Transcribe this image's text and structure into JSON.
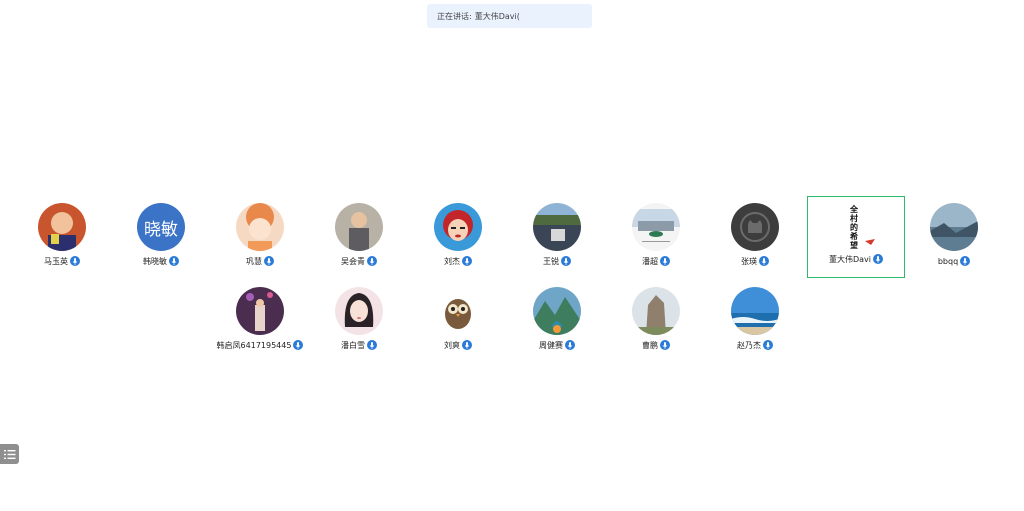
{
  "speaking": {
    "label": "正在讲话:",
    "speaker": "董大伟Davi("
  },
  "participants": [
    {
      "name": "马玉英",
      "avatar_icon": "child-photo-avatar"
    },
    {
      "name": "韩晓敏",
      "avatar_icon": "text-avatar",
      "avatar_text": "晓敏",
      "avatar_color": "#3b73c6"
    },
    {
      "name": "巩慧",
      "avatar_icon": "cartoon-girl-avatar"
    },
    {
      "name": "吴会青",
      "avatar_icon": "child-photo-avatar"
    },
    {
      "name": "刘杰",
      "avatar_icon": "cartoon-redhair-avatar"
    },
    {
      "name": "王锐",
      "avatar_icon": "landscape-avatar"
    },
    {
      "name": "潘超",
      "avatar_icon": "landscape-avatar"
    },
    {
      "name": "张瑛",
      "avatar_icon": "github-cat-avatar"
    },
    {
      "name": "董大伟Davi",
      "avatar_icon": "calligraphy-avatar",
      "avatar_text": "全村的希望",
      "active": true
    },
    {
      "name": "bbqq",
      "avatar_icon": "lake-avatar"
    },
    {
      "name": "韩启凤6417195445",
      "avatar_icon": "photo-avatar"
    },
    {
      "name": "潘白雪",
      "avatar_icon": "cartoon-girl-avatar"
    },
    {
      "name": "刘爽",
      "avatar_icon": "owl-avatar"
    },
    {
      "name": "周健赛",
      "avatar_icon": "mountain-avatar"
    },
    {
      "name": "曹鹏",
      "avatar_icon": "rock-avatar"
    },
    {
      "name": "赵乃杰",
      "avatar_icon": "sea-avatar"
    }
  ],
  "colors": {
    "accent": "#2a7ad8",
    "active_border": "#2dba6b",
    "banner_bg": "#eaf2fe"
  }
}
